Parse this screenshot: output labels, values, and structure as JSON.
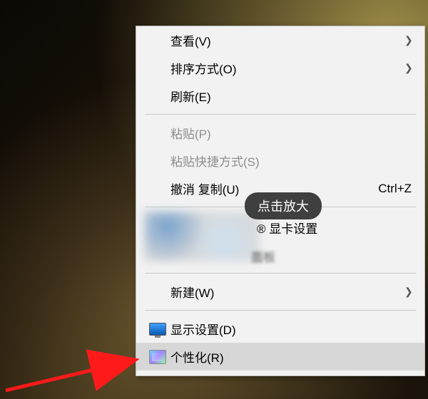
{
  "menu": {
    "view": "查看(V)",
    "sort": "排序方式(O)",
    "refresh": "刷新(E)",
    "paste": "粘贴(P)",
    "paste_shortcut": "粘贴快捷方式(S)",
    "undo": "撤消 复制(U)",
    "undo_shortcut": "Ctrl+Z",
    "gpu_settings_partial": "® 显卡设置",
    "panel_partial": "面板",
    "new": "新建(W)",
    "display": "显示设置(D)",
    "personalize": "个性化(R)"
  },
  "tooltip": "点击放大"
}
